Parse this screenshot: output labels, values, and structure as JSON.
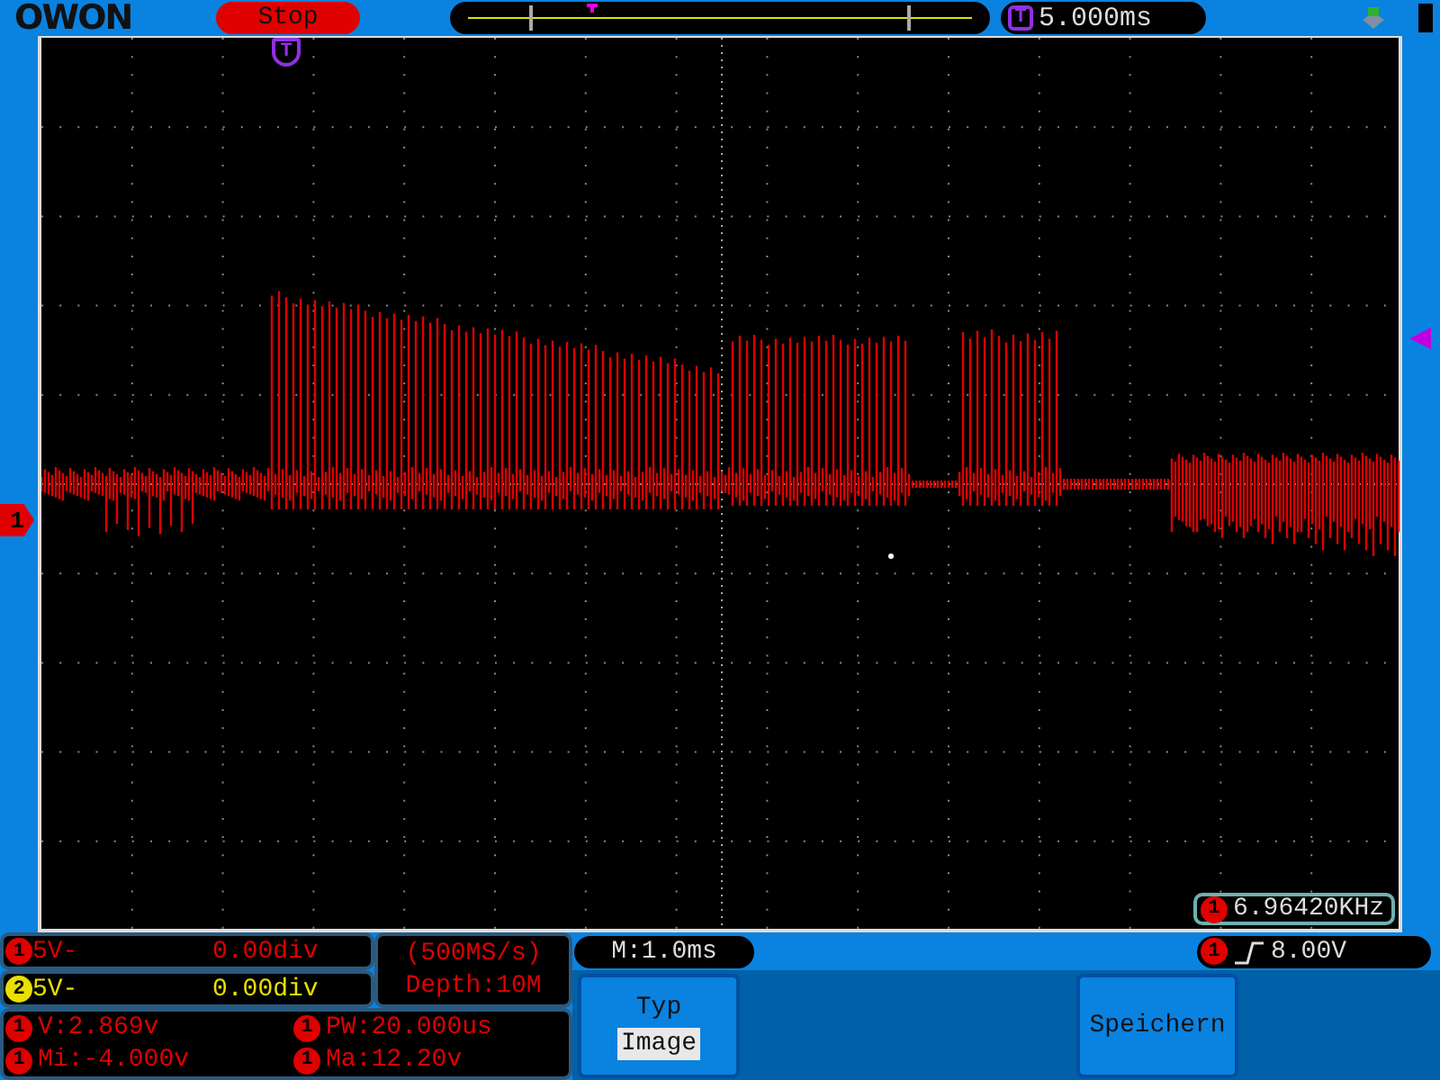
{
  "brand": "OWON",
  "run_state": "Stop",
  "trigger_time": {
    "badge": "T",
    "value": "5.000ms"
  },
  "trigger_marker": "T",
  "channel_marker": "1",
  "frequency": {
    "channel": "1",
    "value": "6.96420KHz"
  },
  "channels": [
    {
      "number": "1",
      "color": "#e00000",
      "scale": "5V-",
      "offset": "0.00div"
    },
    {
      "number": "2",
      "color": "#e8e000",
      "scale": "5V-",
      "offset": "0.00div"
    }
  ],
  "sampling": {
    "rate": "(500MS/s)",
    "depth": "Depth:10M"
  },
  "measurements": [
    {
      "channel": "1",
      "text": "V:2.869v"
    },
    {
      "channel": "1",
      "text": "PW:20.000us"
    },
    {
      "channel": "1",
      "text": "Mi:-4.000v"
    },
    {
      "channel": "1",
      "text": "Ma:12.20v"
    }
  ],
  "timebase": "M:1.0ms",
  "trigger": {
    "channel": "1",
    "level": "8.00V"
  },
  "menu": [
    {
      "kind": "option",
      "label": "Typ",
      "value": "Image"
    },
    {
      "kind": "action",
      "label": "Speichern"
    }
  ]
}
